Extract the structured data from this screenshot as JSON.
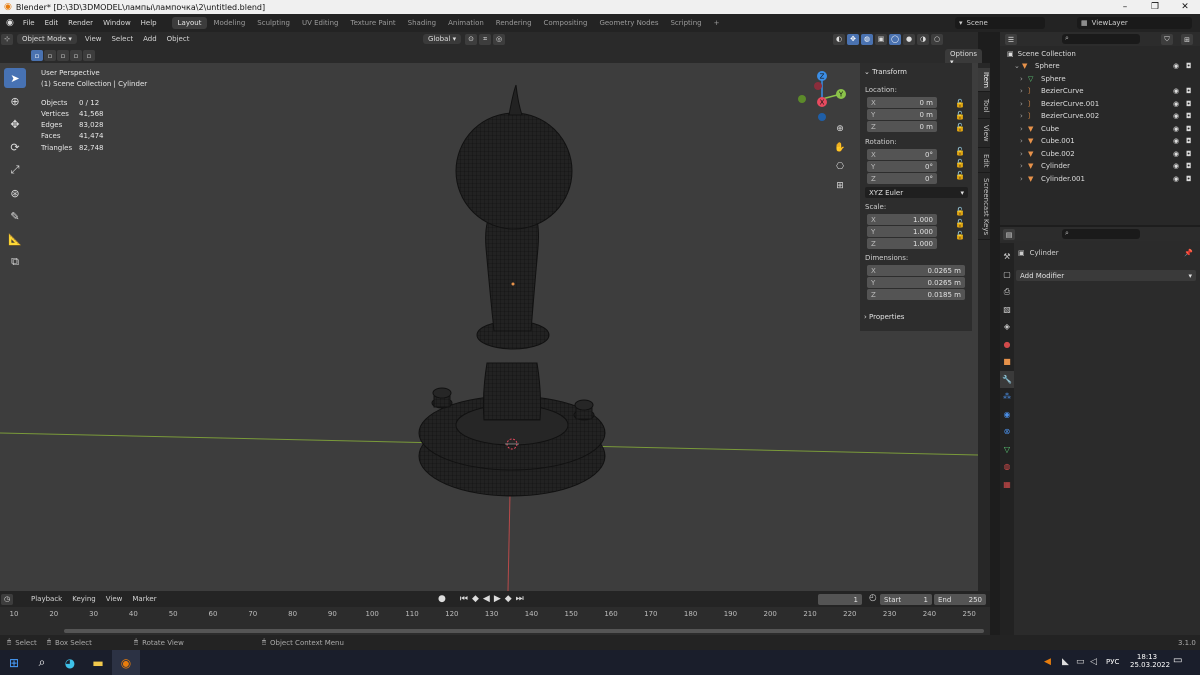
{
  "window": {
    "title": "Blender* [D:\\3D\\3DMODEL\\лампы\\лампочка\\2\\untitled.blend]",
    "minimize": "–",
    "maximize": "❐",
    "close": "✕"
  },
  "menu": {
    "items": [
      "File",
      "Edit",
      "Render",
      "Window",
      "Help"
    ],
    "workspaces": [
      "Layout",
      "Modeling",
      "Sculpting",
      "UV Editing",
      "Texture Paint",
      "Shading",
      "Animation",
      "Rendering",
      "Compositing",
      "Geometry Nodes",
      "Scripting"
    ],
    "add_tab": "+",
    "scene_label": "Scene",
    "viewlayer_label": "ViewLayer"
  },
  "viewport_header": {
    "mode": "Object Mode",
    "menus": [
      "View",
      "Select",
      "Add",
      "Object"
    ],
    "orientation": "Global",
    "options_label": "Options"
  },
  "viewport": {
    "perspective": "User Perspective",
    "collection_path": "(1) Scene Collection | Cylinder",
    "stats": [
      {
        "key": "Objects",
        "value": "0 / 12"
      },
      {
        "key": "Vertices",
        "value": "41,568"
      },
      {
        "key": "Edges",
        "value": "83,028"
      },
      {
        "key": "Faces",
        "value": "41,474"
      },
      {
        "key": "Triangles",
        "value": "82,748"
      }
    ],
    "gizmo": {
      "x": "X",
      "y": "Y",
      "z": "Z"
    }
  },
  "transform": {
    "header": "Transform",
    "location_label": "Location:",
    "location": [
      {
        "axis": "X",
        "value": "0 m"
      },
      {
        "axis": "Y",
        "value": "0 m"
      },
      {
        "axis": "Z",
        "value": "0 m"
      }
    ],
    "rotation_label": "Rotation:",
    "rotation": [
      {
        "axis": "X",
        "value": "0°"
      },
      {
        "axis": "Y",
        "value": "0°"
      },
      {
        "axis": "Z",
        "value": "0°"
      }
    ],
    "rotation_mode": "XYZ Euler",
    "scale_label": "Scale:",
    "scale": [
      {
        "axis": "X",
        "value": "1.000"
      },
      {
        "axis": "Y",
        "value": "1.000"
      },
      {
        "axis": "Z",
        "value": "1.000"
      }
    ],
    "dimensions_label": "Dimensions:",
    "dimensions": [
      {
        "axis": "X",
        "value": "0.0265 m"
      },
      {
        "axis": "Y",
        "value": "0.0265 m"
      },
      {
        "axis": "Z",
        "value": "0.0185 m"
      }
    ],
    "properties_label": "Properties"
  },
  "side_tabs": [
    "Item",
    "Tool",
    "View",
    "Edit",
    "Screencast Keys"
  ],
  "outliner": {
    "root": "Scene Collection",
    "items": [
      {
        "name": "Sphere",
        "indent": 1,
        "icon": "object-icon"
      },
      {
        "name": "Sphere",
        "indent": 2,
        "icon": "mesh-icon"
      },
      {
        "name": "BezierCurve",
        "indent": 2,
        "icon": "curve-icon"
      },
      {
        "name": "BezierCurve.001",
        "indent": 2,
        "icon": "curve-icon"
      },
      {
        "name": "BezierCurve.002",
        "indent": 2,
        "icon": "curve-icon"
      },
      {
        "name": "Cube",
        "indent": 2,
        "icon": "object-icon"
      },
      {
        "name": "Cube.001",
        "indent": 2,
        "icon": "object-icon"
      },
      {
        "name": "Cube.002",
        "indent": 2,
        "icon": "object-icon"
      },
      {
        "name": "Cylinder",
        "indent": 2,
        "icon": "object-icon"
      },
      {
        "name": "Cylinder.001",
        "indent": 2,
        "icon": "object-icon"
      }
    ]
  },
  "properties": {
    "object_name": "Cylinder",
    "add_modifier": "Add Modifier"
  },
  "timeline": {
    "menus": [
      "Playback",
      "Keying",
      "View",
      "Marker"
    ],
    "current_frame": "1",
    "start_label": "Start",
    "start": "1",
    "end_label": "End",
    "end": "250",
    "ticks": [
      "10",
      "20",
      "30",
      "40",
      "50",
      "60",
      "70",
      "80",
      "90",
      "100",
      "110",
      "120",
      "130",
      "140",
      "150",
      "160",
      "170",
      "180",
      "190",
      "200",
      "210",
      "220",
      "230",
      "240",
      "250"
    ]
  },
  "statusbar": {
    "select": "Select",
    "box_select": "Box Select",
    "rotate_view": "Rotate View",
    "context_menu": "Object Context Menu",
    "version": "3.1.0"
  },
  "taskbar": {
    "language": "РУС",
    "time": "18:13",
    "date": "25.03.2022"
  },
  "colors": {
    "accent": "#4772b3",
    "x_axis": "#e84a5f",
    "y_axis": "#8bc34a",
    "z_axis": "#3b8ee6",
    "object_orange": "#e7924a"
  }
}
